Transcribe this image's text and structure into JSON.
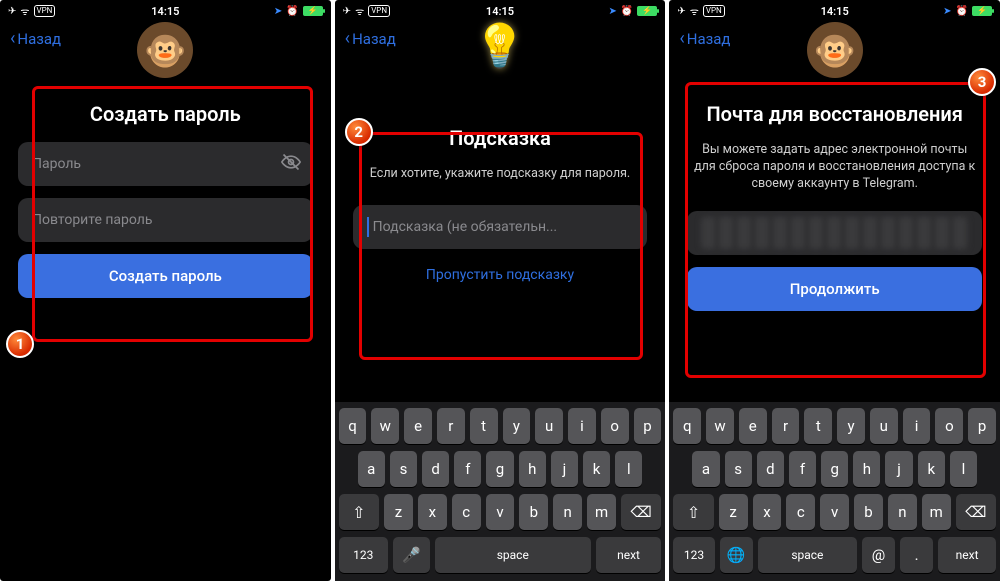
{
  "status": {
    "time": "14:15",
    "vpn": "VPN",
    "airplane": "✈",
    "wifi": "ᯤ",
    "nav_arrow": "➤",
    "alarm": "⏰",
    "bolt": "⚡"
  },
  "nav": {
    "back_label": "Назад"
  },
  "screen1": {
    "title": "Создать пароль",
    "password_placeholder": "Пароль",
    "repeat_placeholder": "Повторите пароль",
    "button": "Создать пароль",
    "step": "1"
  },
  "screen2": {
    "title": "Подсказка",
    "subtitle": "Если хотите, укажите подсказку для пароля.",
    "hint_placeholder": "Подсказка (не обязательн...",
    "skip": "Пропустить подсказку",
    "step": "2"
  },
  "screen3": {
    "title": "Почта для восстановления",
    "subtitle": "Вы можете задать адрес электронной почты для сброса пароля и восстановления доступа к своему аккаунту в Telegram.",
    "button": "Продолжить",
    "step": "3"
  },
  "keyboard": {
    "rows": {
      "r1": [
        "q",
        "w",
        "e",
        "r",
        "t",
        "y",
        "u",
        "i",
        "o",
        "p"
      ],
      "r2": [
        "a",
        "s",
        "d",
        "f",
        "g",
        "h",
        "j",
        "k",
        "l"
      ],
      "r3_mid": [
        "z",
        "x",
        "c",
        "v",
        "b",
        "n",
        "m"
      ]
    },
    "shift": "⇧",
    "backspace": "⌫",
    "num": "123",
    "mic": "🎤",
    "globe": "🌐",
    "space": "space",
    "at": "@",
    "dot": ".",
    "next": "next"
  }
}
